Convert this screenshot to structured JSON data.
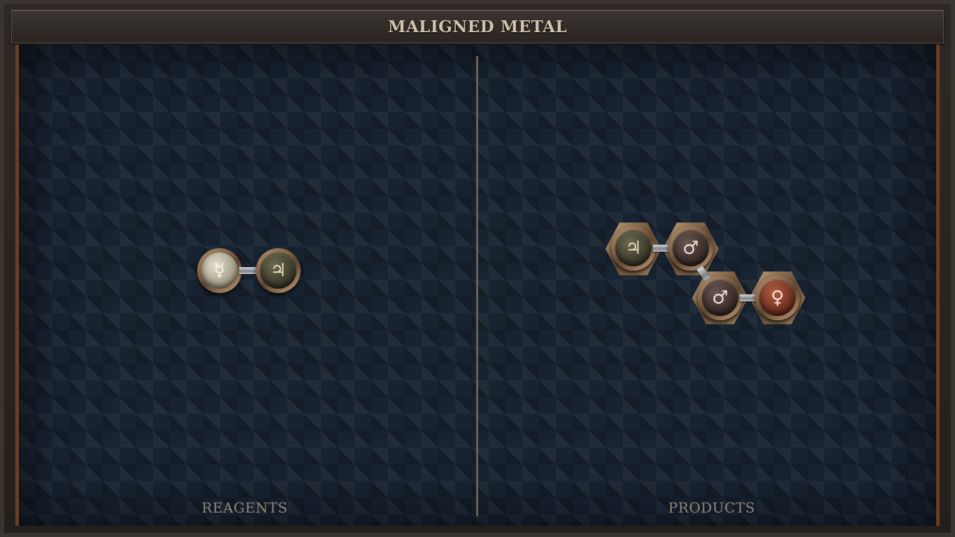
{
  "puzzle": {
    "title": "MALIGNED METAL"
  },
  "panels": {
    "reagents_label": "REAGENTS",
    "products_label": "PRODUCTS"
  },
  "atoms": {
    "reagent_1": {
      "element": "quicksilver",
      "symbol": "☿"
    },
    "reagent_2": {
      "element": "tin",
      "symbol": "♃"
    },
    "product_1": {
      "element": "tin",
      "symbol": "♃"
    },
    "product_2": {
      "element": "iron",
      "symbol": "♂"
    },
    "product_3": {
      "element": "iron",
      "symbol": "♂"
    },
    "product_4": {
      "element": "copper",
      "symbol": "♀"
    }
  },
  "colors": {
    "board": "#182331",
    "frame": "#3a342e",
    "side_trim": "#6b3e22",
    "title_text": "#d2c3ae",
    "label_text": "#8f877d"
  }
}
